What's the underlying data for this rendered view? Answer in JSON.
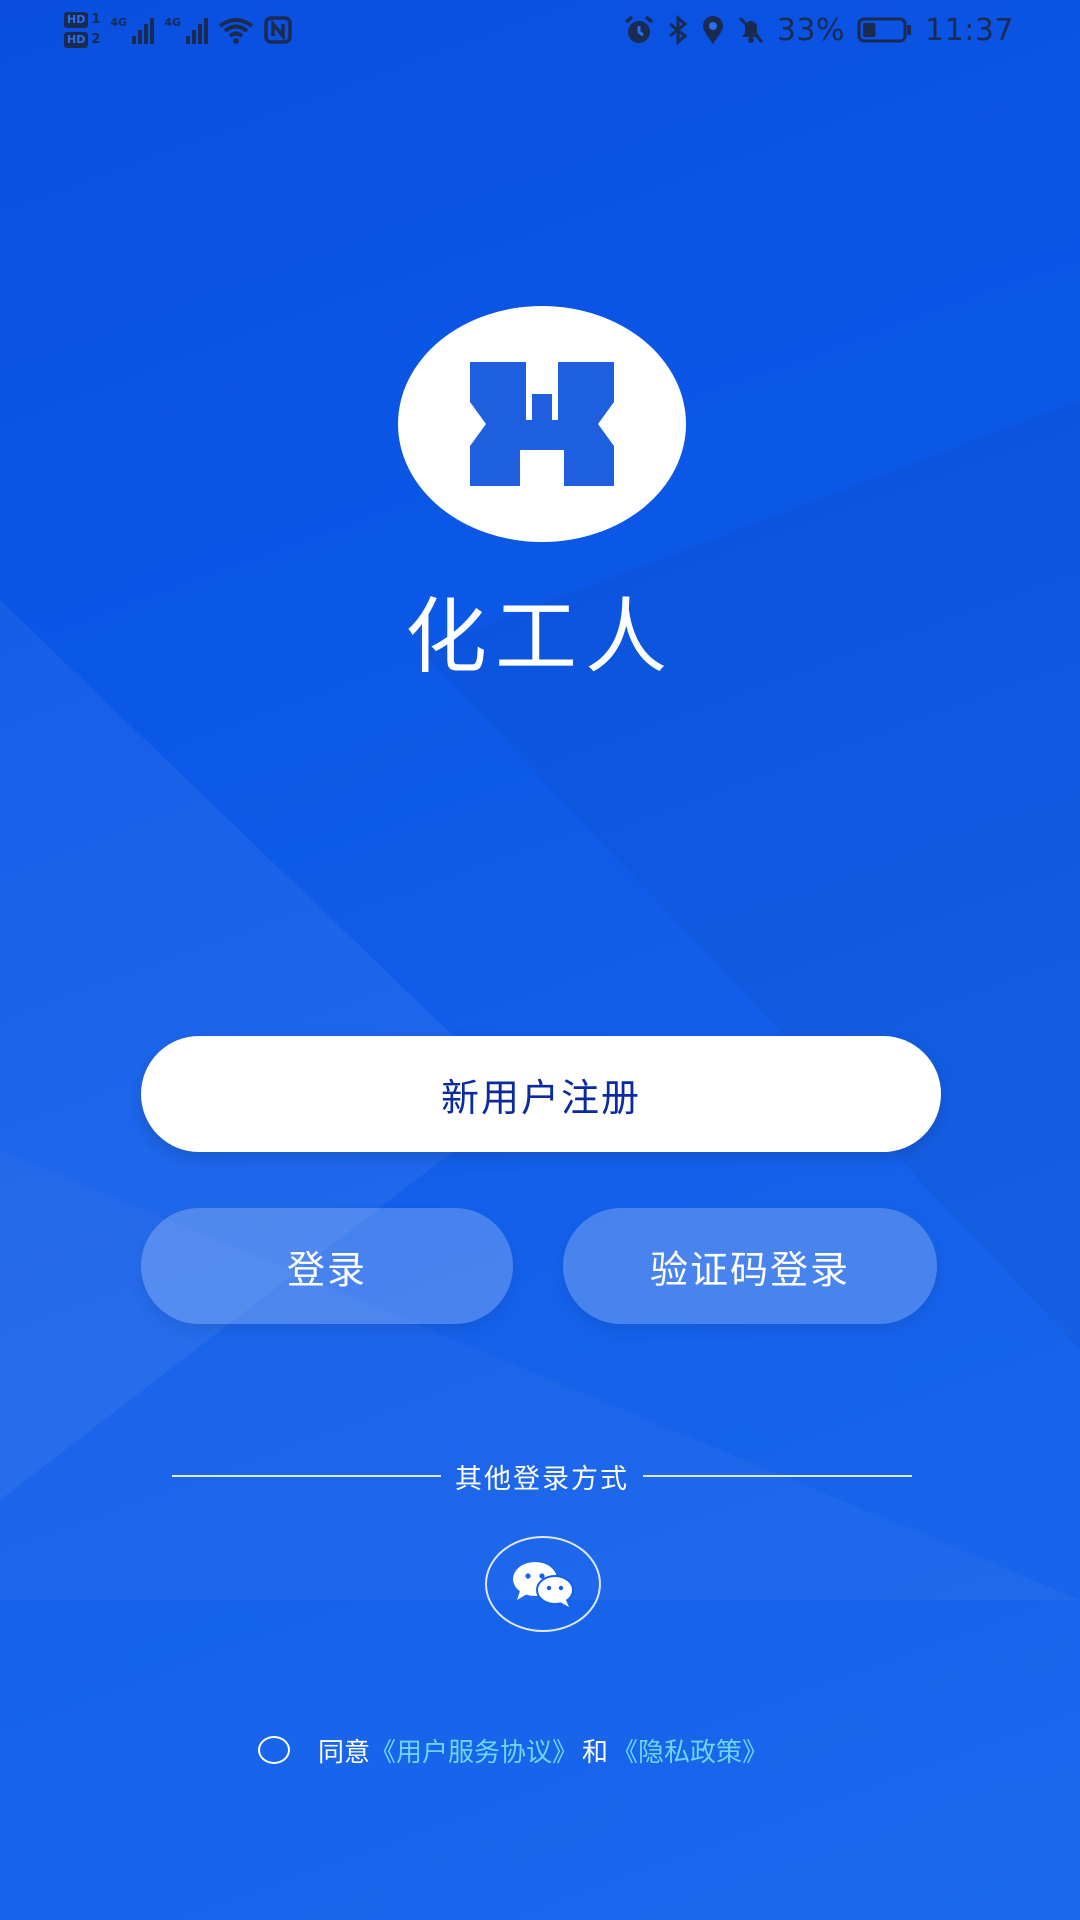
{
  "status_bar": {
    "sim1_label": "HD",
    "sim1_slot": "1",
    "sim2_label": "HD",
    "sim2_slot": "2",
    "network1": "4G",
    "network2": "4G",
    "battery_percent": "33%",
    "battery_level": 0.33,
    "time": "11:37",
    "icons": [
      "alarm-icon",
      "bluetooth-icon",
      "location-icon",
      "mute-bell-icon",
      "battery-icon",
      "wifi-icon",
      "nfc-icon",
      "signal-icon"
    ]
  },
  "app": {
    "name": "化工人",
    "logo_icon": "hgr-logo-icon"
  },
  "buttons": {
    "register": "新用户注册",
    "login": "登录",
    "code_login": "验证码登录"
  },
  "other_login": {
    "label": "其他登录方式",
    "wechat_icon": "wechat-icon"
  },
  "agreement": {
    "prefix": "同意",
    "user_agreement": "《用户服务协议》",
    "and": "和",
    "privacy_policy": "《隐私政策》"
  },
  "colors": {
    "background": "#0b57e6",
    "logo_blue": "#1e5fe0",
    "register_text": "#0b2aa0",
    "link": "#6fd4f0"
  }
}
